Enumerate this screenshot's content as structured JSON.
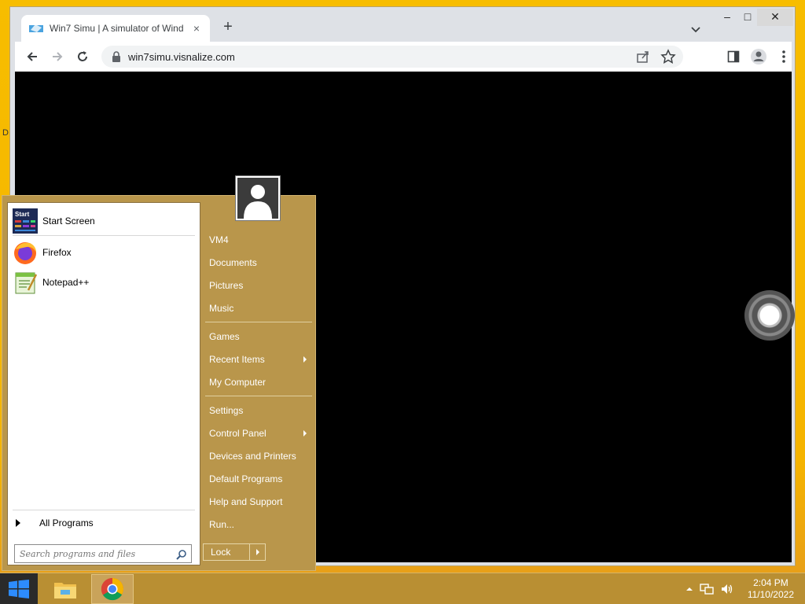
{
  "desktop": {
    "edge_letter": "D"
  },
  "browser": {
    "tab_title": "Win7 Simu | A simulator of Wind",
    "new_tab_label": "+",
    "close_tab_label": "×",
    "url": "win7simu.visnalize.com",
    "window_controls": {
      "minimize": "–",
      "maximize": "□",
      "close": "✕"
    }
  },
  "start_menu": {
    "pinned": [
      {
        "label": "Start Screen",
        "icon": "start-screen-icon"
      },
      {
        "label": "Firefox",
        "icon": "firefox-icon"
      },
      {
        "label": "Notepad++",
        "icon": "notepadpp-icon"
      }
    ],
    "all_programs": "All Programs",
    "search_placeholder": "Search programs and files",
    "right_items": [
      {
        "label": "VM4",
        "submenu": false
      },
      {
        "label": "Documents",
        "submenu": false
      },
      {
        "label": "Pictures",
        "submenu": false
      },
      {
        "label": "Music",
        "submenu": false
      },
      {
        "label": "Games",
        "submenu": false
      },
      {
        "label": "Recent Items",
        "submenu": true
      },
      {
        "label": "My Computer",
        "submenu": false
      },
      {
        "label": "Settings",
        "submenu": false
      },
      {
        "label": "Control Panel",
        "submenu": true
      },
      {
        "label": "Devices and Printers",
        "submenu": false
      },
      {
        "label": "Default Programs",
        "submenu": false
      },
      {
        "label": "Help and Support",
        "submenu": false
      },
      {
        "label": "Run...",
        "submenu": false
      }
    ],
    "shutdown_label": "Lock"
  },
  "taskbar": {
    "apps": [
      "file-explorer-icon",
      "chrome-icon"
    ],
    "clock_time": "2:04 PM",
    "clock_date": "11/10/2022"
  },
  "colors": {
    "desktop": "#f5b800",
    "start_menu": "#b9964b",
    "taskbar": "#b98f33",
    "content": "#000000"
  }
}
